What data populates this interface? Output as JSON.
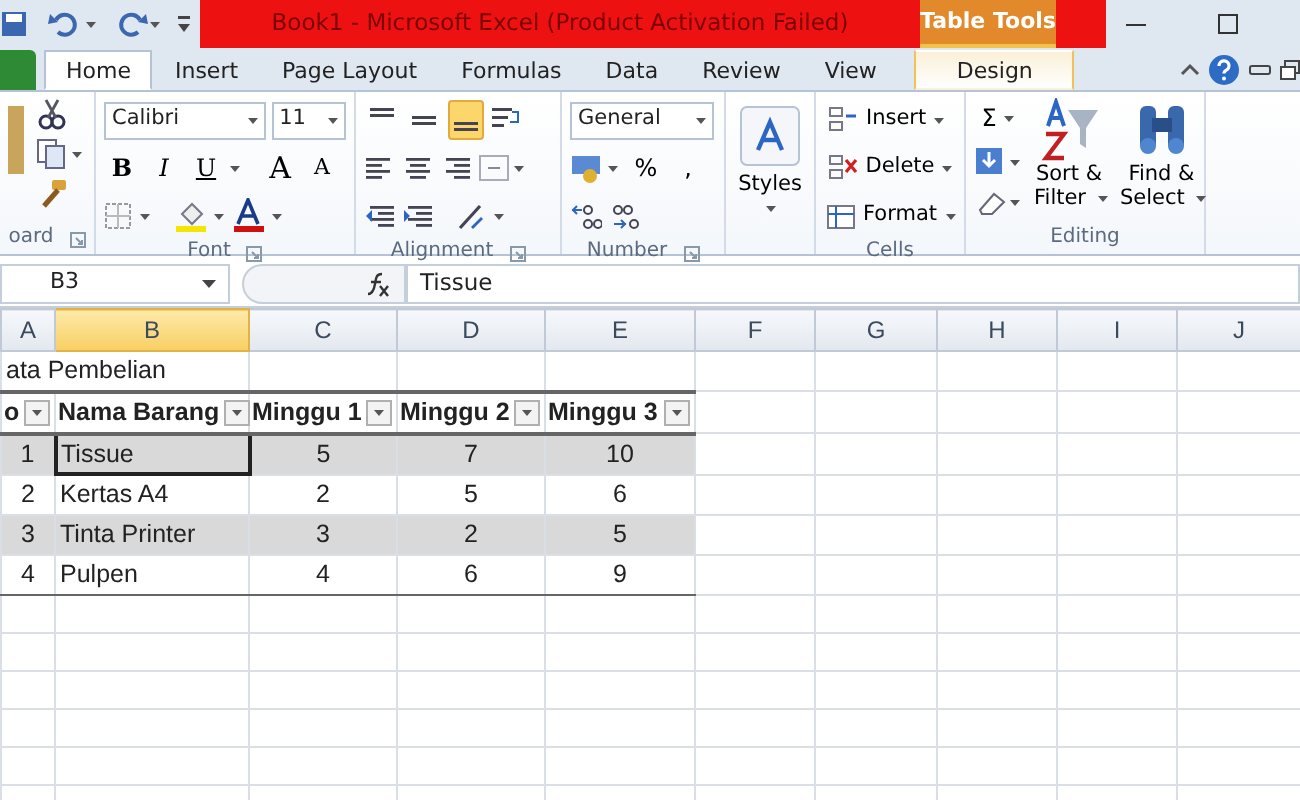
{
  "title_bar": {
    "title": "Book1  -  Microsoft Excel (Product Activation Failed)",
    "contextual_tab": "Table Tools"
  },
  "tabs": [
    {
      "label": "Home",
      "selected": true,
      "kind": "normal"
    },
    {
      "label": "Insert",
      "selected": false,
      "kind": "normal"
    },
    {
      "label": "Page Layout",
      "selected": false,
      "kind": "normal"
    },
    {
      "label": "Formulas",
      "selected": false,
      "kind": "normal"
    },
    {
      "label": "Data",
      "selected": false,
      "kind": "normal"
    },
    {
      "label": "Review",
      "selected": false,
      "kind": "normal"
    },
    {
      "label": "View",
      "selected": false,
      "kind": "normal"
    },
    {
      "label": "Design",
      "selected": false,
      "kind": "contextual"
    }
  ],
  "ribbon": {
    "clipboard": {
      "label": "oard"
    },
    "font": {
      "label": "Font",
      "font_name": "Calibri",
      "font_size": "11",
      "bold": "B",
      "italic": "I",
      "underline": "U",
      "grow": "A",
      "shrink": "A"
    },
    "alignment": {
      "label": "Alignment",
      "vertical_buttons": [
        {
          "selected": false
        },
        {
          "selected": false
        },
        {
          "selected": true
        }
      ]
    },
    "number": {
      "label": "Number",
      "format": "General",
      "percent": "%",
      "comma": ","
    },
    "styles": {
      "label": "Styles"
    },
    "cells": {
      "label": "Cells",
      "buttons": [
        "Insert",
        "Delete",
        "Format"
      ]
    },
    "editing": {
      "label": "Editing",
      "sum": "Σ",
      "sort": [
        "Sort &",
        "Filter"
      ],
      "find": [
        "Find &",
        "Select"
      ]
    }
  },
  "formula_bar": {
    "name_box": "B3",
    "value": "Tissue"
  },
  "columns": [
    {
      "label": "A",
      "selected": false
    },
    {
      "label": "B",
      "selected": true
    },
    {
      "label": "C",
      "selected": false
    },
    {
      "label": "D",
      "selected": false
    },
    {
      "label": "E",
      "selected": false
    },
    {
      "label": "F",
      "selected": false
    },
    {
      "label": "G",
      "selected": false
    },
    {
      "label": "H",
      "selected": false
    },
    {
      "label": "I",
      "selected": false
    },
    {
      "label": "J",
      "selected": false
    }
  ],
  "rows": [
    {
      "kind": "title",
      "cells": [
        {
          "text": "ata Pembelian",
          "selected": false
        }
      ]
    },
    {
      "kind": "header",
      "cells": [
        {
          "text": "o",
          "selected": false
        },
        {
          "text": "Nama Barang",
          "selected": false
        },
        {
          "text": "Minggu 1",
          "selected": false
        },
        {
          "text": "Minggu 2",
          "selected": false
        },
        {
          "text": "Minggu 3",
          "selected": false
        }
      ]
    },
    {
      "kind": "data",
      "cells": [
        {
          "text": "1",
          "selected": false
        },
        {
          "text": "Tissue",
          "selected": true
        },
        {
          "text": "5",
          "selected": false
        },
        {
          "text": "7",
          "selected": false
        },
        {
          "text": "10",
          "selected": false
        }
      ]
    },
    {
      "kind": "data",
      "cells": [
        {
          "text": "2",
          "selected": false
        },
        {
          "text": "Kertas A4",
          "selected": false
        },
        {
          "text": "2",
          "selected": false
        },
        {
          "text": "5",
          "selected": false
        },
        {
          "text": "6",
          "selected": false
        }
      ]
    },
    {
      "kind": "data",
      "cells": [
        {
          "text": "3",
          "selected": false
        },
        {
          "text": "Tinta Printer",
          "selected": false
        },
        {
          "text": "3",
          "selected": false
        },
        {
          "text": "2",
          "selected": false
        },
        {
          "text": "5",
          "selected": false
        }
      ]
    },
    {
      "kind": "data",
      "cells": [
        {
          "text": "4",
          "selected": false
        },
        {
          "text": "Pulpen",
          "selected": false
        },
        {
          "text": "4",
          "selected": false
        },
        {
          "text": "6",
          "selected": false
        },
        {
          "text": "9",
          "selected": false
        }
      ]
    }
  ]
}
